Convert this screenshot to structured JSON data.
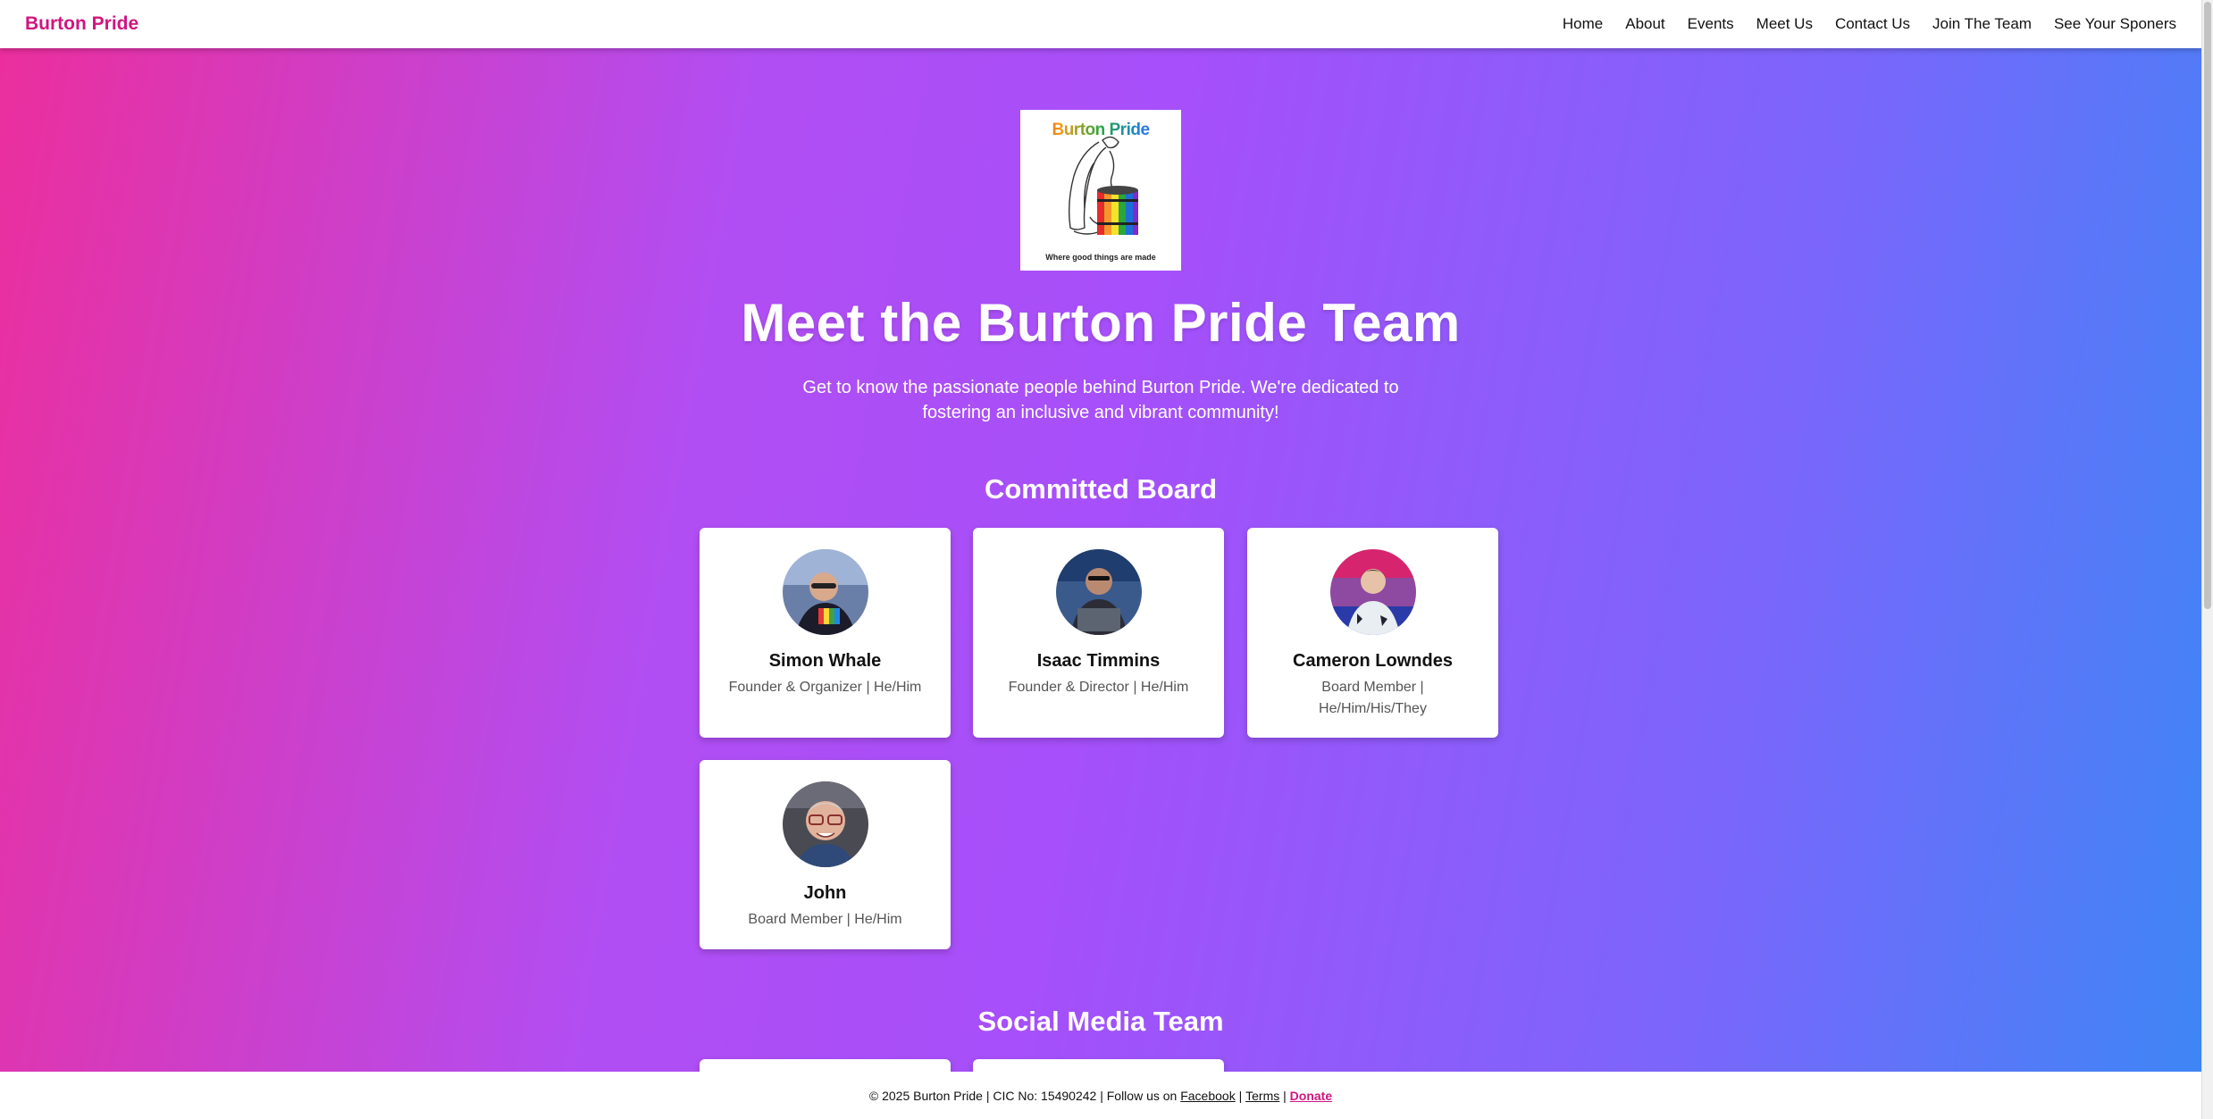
{
  "nav": {
    "brand": "Burton Pride",
    "links": [
      "Home",
      "About",
      "Events",
      "Meet Us",
      "Contact Us",
      "Join The Team",
      "See Your Sponers"
    ]
  },
  "hero": {
    "logo_title": "Burton Pride",
    "logo_tagline": "Where good things are made",
    "heading": "Meet the Burton Pride Team",
    "intro": "Get to know the passionate people behind Burton Pride. We're dedicated to fostering an inclusive and vibrant community!"
  },
  "sections": {
    "board": {
      "title": "Committed Board",
      "members": [
        {
          "name": "Simon Whale",
          "role": "Founder & Organizer | He/Him"
        },
        {
          "name": "Isaac Timmins",
          "role": "Founder & Director | He/Him"
        },
        {
          "name": "Cameron Lowndes",
          "role": "Board Member | He/Him/His/They"
        },
        {
          "name": "John",
          "role": "Board Member | He/Him"
        }
      ]
    },
    "social": {
      "title": "Social Media Team"
    }
  },
  "footer": {
    "text": "© 2025 Burton Pride | CIC No: 15490242 | Follow us on",
    "facebook": "Facebook",
    "sep1": "|",
    "terms": "Terms",
    "sep2": "|",
    "donate": "Donate"
  },
  "colors": {
    "brand": "#d0157f",
    "gradient_start": "#ec2e9c",
    "gradient_mid": "#a64ffa",
    "gradient_end": "#3d86f6"
  }
}
